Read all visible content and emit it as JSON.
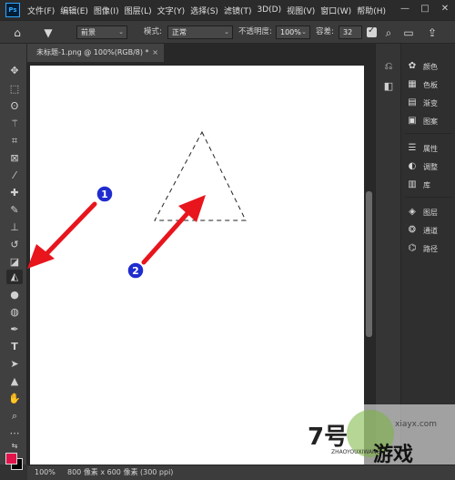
{
  "app": {
    "logo_text": "Ps"
  },
  "menu": [
    "文件(F)",
    "编辑(E)",
    "图像(I)",
    "图层(L)",
    "文字(Y)",
    "选择(S)",
    "滤镜(T)",
    "3D(D)",
    "视图(V)",
    "窗口(W)",
    "帮助(H)"
  ],
  "window_controls": {
    "minimize": "—",
    "maximize": "□",
    "close": "✕"
  },
  "options_bar": {
    "fill_source": "前景",
    "mode_label": "模式:",
    "mode_value": "正常",
    "opacity_label": "不透明度:",
    "opacity_value": "100%",
    "tolerance_label": "容差:",
    "tolerance_value": "32"
  },
  "document": {
    "tab_title": "未标题-1.png @ 100%(RGB/8) *",
    "close": "×"
  },
  "colors": {
    "foreground": "#e0144b",
    "background": "#000000",
    "annotation": "#e8151d",
    "badge": "#1f2ccf"
  },
  "panels": {
    "group1": [
      "颜色",
      "色板",
      "渐变",
      "图案"
    ],
    "group2": [
      "属性",
      "调整",
      "库"
    ],
    "group3": [
      "图层",
      "通道",
      "路径"
    ]
  },
  "status": {
    "zoom": "100%",
    "info": "800 像素 x 600 像素 (300 ppi)"
  },
  "annotations": {
    "badge1": "1",
    "badge2": "2"
  },
  "watermark": {
    "logo": "7号",
    "title": "游戏",
    "pinyin": "ZHAOYOUXIWANG",
    "url": "xiayx.com"
  }
}
